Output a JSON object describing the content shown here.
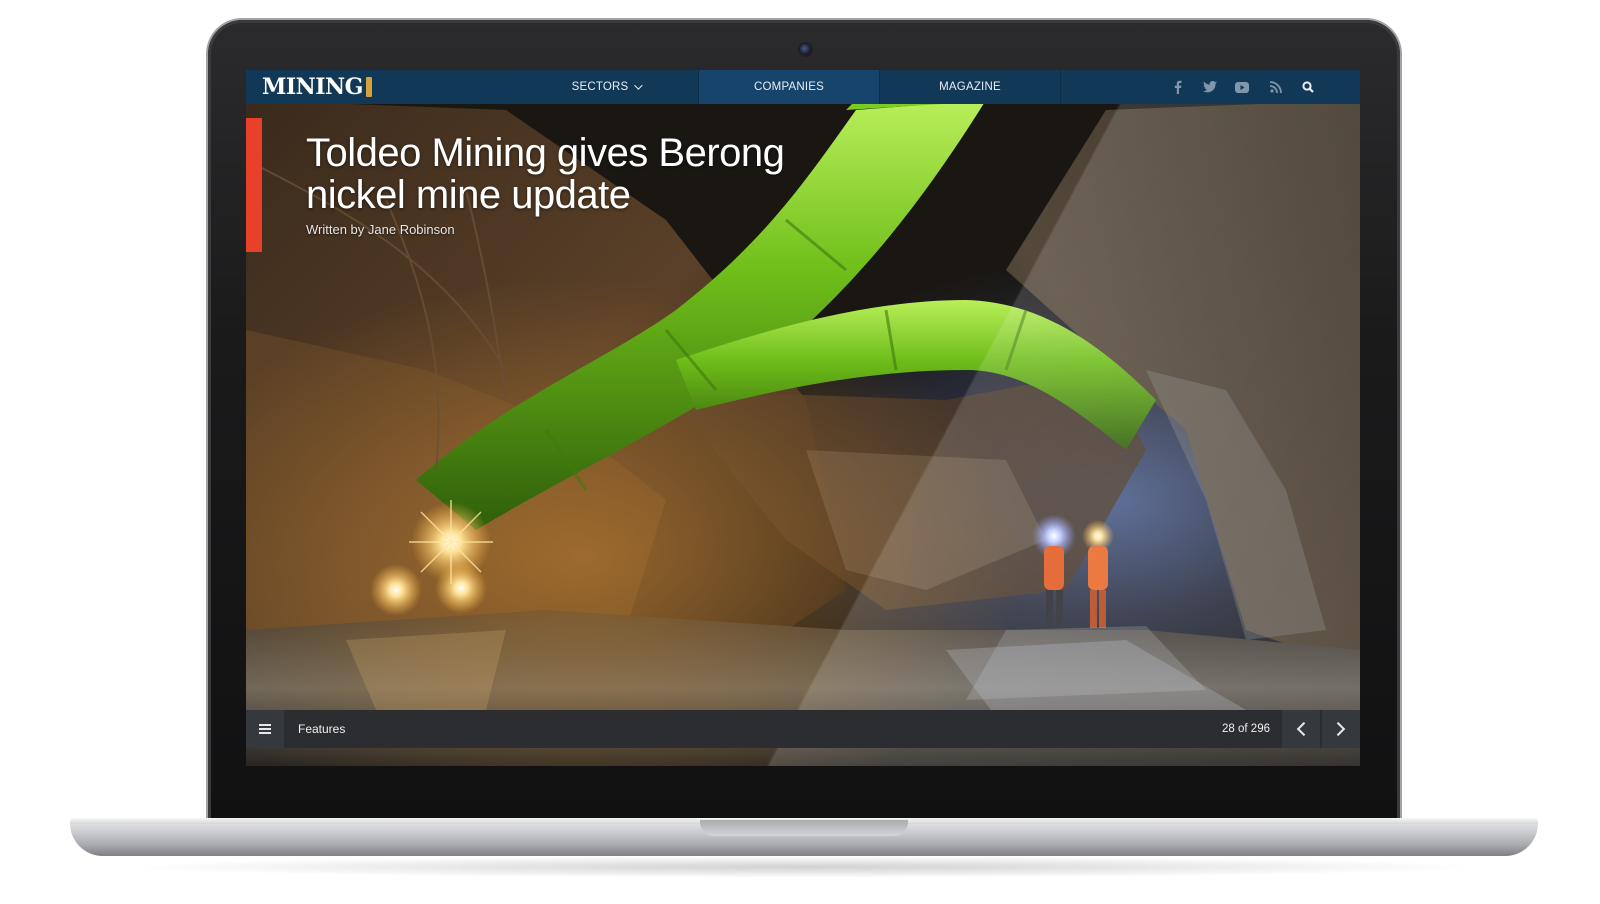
{
  "nav": {
    "logo": "MINING",
    "items": [
      {
        "label": "SECTORS"
      },
      {
        "label": "COMPANIES"
      },
      {
        "label": "MAGAZINE"
      }
    ],
    "social_icons": [
      "facebook-icon",
      "twitter-icon",
      "youtube-icon",
      "rss-icon",
      "search-icon"
    ]
  },
  "article": {
    "title": "Toldeo Mining gives Berong nickel mine update",
    "byline": "Written by Jane Robinson"
  },
  "footer_bar": {
    "section": "Features",
    "page_counter": "28 of 296"
  },
  "colors": {
    "nav_background": "#123857",
    "accent": "#e8402b",
    "bottom_bar": "#2b2d30",
    "pipe_green": "#6fbe1a"
  }
}
